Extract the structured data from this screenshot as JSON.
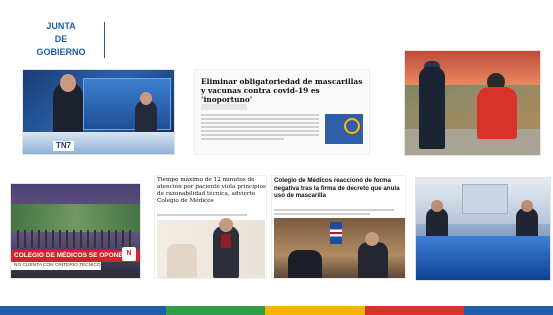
{
  "logo": {
    "line1": "JUNTA",
    "line2": "DE",
    "line3": "GOBIERNO"
  },
  "clippings": {
    "tv1": {
      "channel_bug": "TN7"
    },
    "article1": {
      "headline": "Eliminar obligatoriedad de mascarillas y vacunas contra covid-19 es ‘inoportuno’"
    },
    "tv2": {
      "lower_third": "COLEGIO DE MÉDICOS SE OPONE",
      "subtitle": "NO CUENTA CON CRITERIO TÉCNICO",
      "bug": "N"
    },
    "article2": {
      "headline": "Tiempo máximo de 12 minutos de atención por paciente viola principios de razonabilidad técnica, advierte Colegio de Médicos"
    },
    "article3": {
      "headline": "Colegio de Médicos reaccionó de forma negativa tras la firma de decreto que anula uso de mascarilla"
    }
  },
  "colors": {
    "brand_blue": "#1f5fa8",
    "footer_stripes": [
      "#1f5fa8",
      "#2f9e44",
      "#f4b400",
      "#d9322b",
      "#1f5fa8"
    ]
  }
}
